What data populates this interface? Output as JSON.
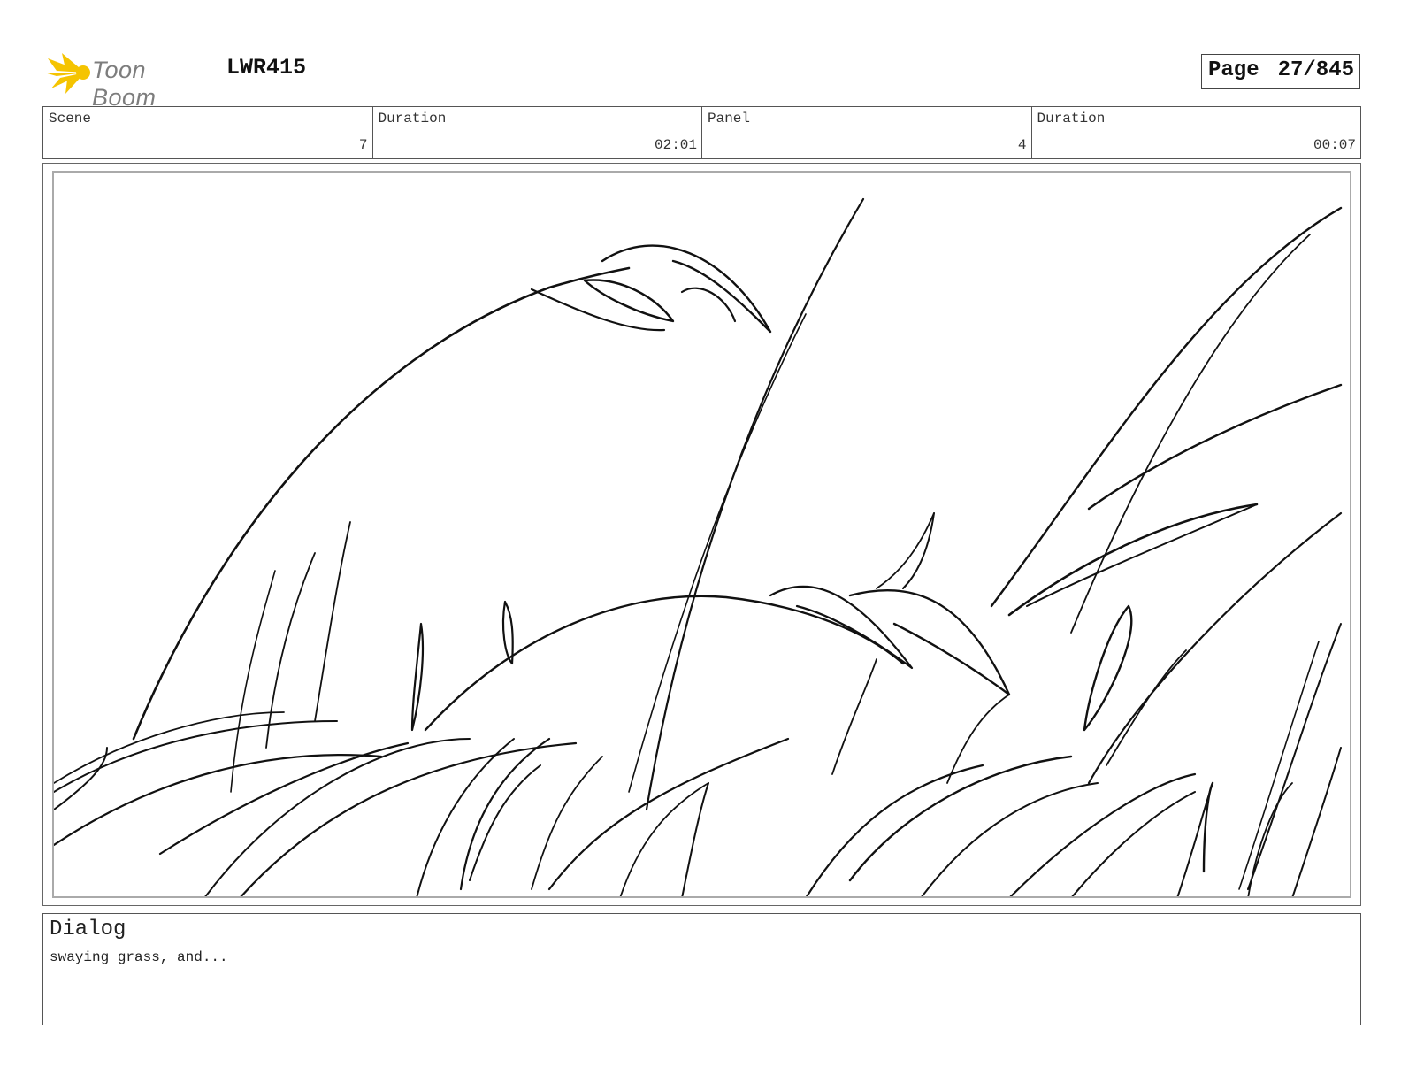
{
  "header": {
    "logo_text": "Toon Boom",
    "project_code": "LWR415",
    "page_label": "Page",
    "page_value": "27/845"
  },
  "info": {
    "scene_label": "Scene",
    "scene_value": "7",
    "scene_duration_label": "Duration",
    "scene_duration_value": "02:01",
    "panel_label": "Panel",
    "panel_value": "4",
    "panel_duration_label": "Duration",
    "panel_duration_value": "00:07"
  },
  "dialog": {
    "title": "Dialog",
    "text": "swaying grass, and..."
  },
  "colors": {
    "logo_star": "#f5c400",
    "logo_text": "#7d7d7d",
    "sketch_stroke": "#111111"
  }
}
